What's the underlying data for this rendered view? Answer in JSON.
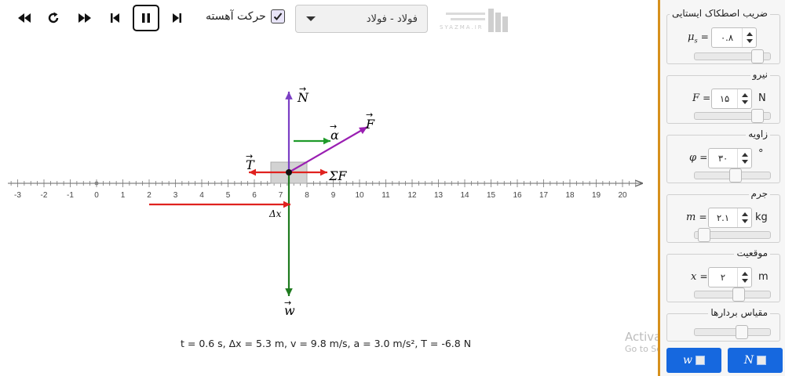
{
  "toolbar": {
    "slow_motion_label": "حرکت آهسته",
    "slow_motion_checked": true,
    "material_value": "فولاد - فولاد"
  },
  "logo": {
    "brand_text": "SYAZMA.IR"
  },
  "scene": {
    "axis_ticks": [
      "-3",
      "-2",
      "-1",
      "0",
      "1",
      "2",
      "3",
      "4",
      "5",
      "6",
      "7",
      "8",
      "9",
      "10",
      "11",
      "12",
      "13",
      "14",
      "15",
      "16",
      "17",
      "18",
      "19",
      "20"
    ],
    "labels": {
      "normal": "N",
      "force": "F",
      "accel": "α",
      "tension": "T",
      "net": "ΣF",
      "weight": "w",
      "displacement": "Δx"
    },
    "colors": {
      "normal": "#7b3fc4",
      "force": "#9a1fb2",
      "accel": "#1f9a2a",
      "tension": "#e0221f",
      "weight": "#1e7a1e",
      "displacement": "#e0221f"
    }
  },
  "status": {
    "line": "t = 0.6 s,  Δx = 5.3 m,  v = 9.8 m/s,  a = 3.0 m/s²,  T = -6.8 N"
  },
  "panel": {
    "friction": {
      "title": "ضریب اصطکاک ایستایی",
      "symbol": "μ",
      "sub": "s",
      "value": "۰.۸",
      "unit": "",
      "level": 0.9
    },
    "force": {
      "title": "نیرو",
      "symbol": "F",
      "value": "۱۵",
      "unit": "N",
      "level": 0.9
    },
    "angle": {
      "title": "زاویه",
      "symbol": "φ",
      "value": "۳۰",
      "unit": "°",
      "level": 0.55
    },
    "mass": {
      "title": "جرم",
      "symbol": "m",
      "value": "۲.۱",
      "unit": "kg",
      "level": 0.05
    },
    "position": {
      "title": "موقعیت",
      "symbol": "x",
      "value": "۲",
      "unit": "m",
      "level": 0.6
    },
    "vector_scale": {
      "title": "مقیاس بردارها",
      "level": 0.65
    },
    "buttons": {
      "weight_label": "w",
      "normal_label": "N"
    }
  },
  "watermark": {
    "line1": "Activate Windows",
    "line2": "Go to Settings to activate Windows."
  }
}
